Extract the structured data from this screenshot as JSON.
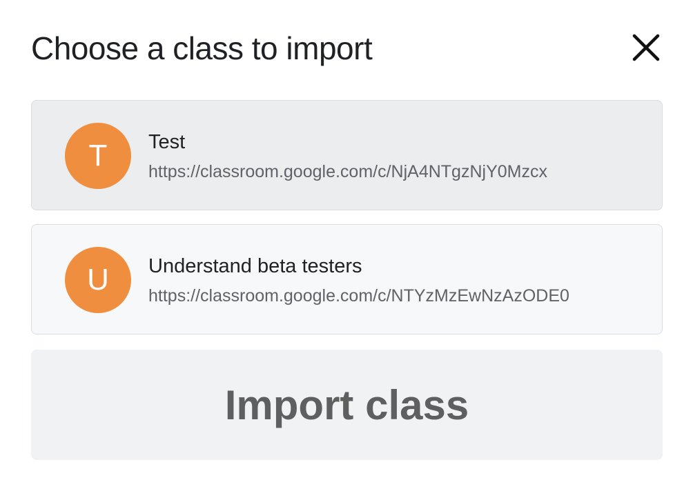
{
  "dialog": {
    "title": "Choose a class to import",
    "close_icon": "close-icon"
  },
  "classes": [
    {
      "initial": "T",
      "name": "Test",
      "url": "https://classroom.google.com/c/NjA4NTgzNjY0Mzcx",
      "selected": true
    },
    {
      "initial": "U",
      "name": "Understand beta testers",
      "url": "https://classroom.google.com/c/NTYzMzEwNzAzODE0",
      "selected": false
    }
  ],
  "import_button": {
    "label": "Import class"
  },
  "colors": {
    "avatar": "#f08e3f",
    "selected_item_bg": "#ecedef",
    "item_bg": "#f7f8f9",
    "button_bg": "#f1f2f4",
    "button_text": "#5f5f5f"
  }
}
